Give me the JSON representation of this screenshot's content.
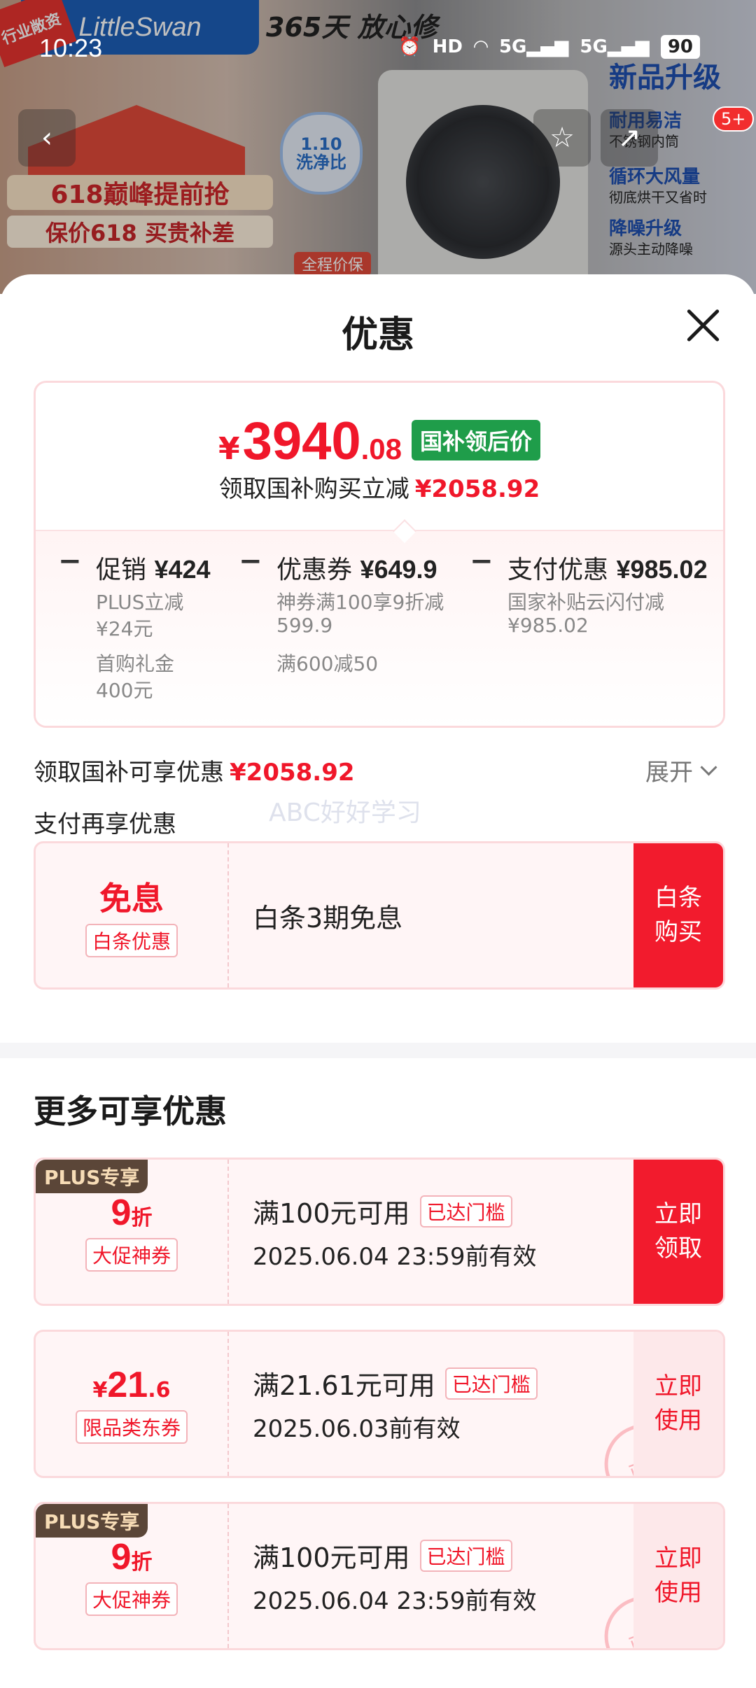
{
  "status_bar": {
    "time": "10:23",
    "icons": [
      "alarm-icon",
      "hd-icon",
      "wifi-icon",
      "signal-5g-1-icon",
      "signal-5g-2-icon"
    ],
    "hd_label": "HD",
    "net1": "5G",
    "net2": "5G",
    "battery": "90"
  },
  "banner": {
    "brand": "LittleSwan",
    "industry_tag": "行业敞资",
    "slogan": "365天 放心修",
    "promo_title": "618巅峰提前抢",
    "promo_sub": "保价618 买贵补差",
    "badge_110_line1": "1.10",
    "badge_110_line2": "洗净比",
    "full_guarantee": "全程价保",
    "feature_title": "新品升级",
    "features": [
      {
        "title": "耐用易洁",
        "sub": "不锈钢内筒"
      },
      {
        "title": "循环大风量",
        "sub": "彻底烘干又省时"
      },
      {
        "title": "降噪升级",
        "sub": "源头主动降噪"
      }
    ],
    "cart_badge": "5+"
  },
  "sheet": {
    "title": "优惠"
  },
  "price_card": {
    "currency": "¥",
    "price_int": "3940",
    "price_dec": ".08",
    "price_tag": "国补领后价",
    "subtitle": "领取国补购买立减",
    "subtitle_amount": "¥2058.92",
    "breakdown": [
      {
        "minus": "−",
        "title": "促销",
        "amount": "¥424",
        "lines": [
          "PLUS立减",
          "¥24元",
          "首购礼金",
          "400元"
        ]
      },
      {
        "minus": "−",
        "title": "优惠券",
        "amount": "¥649.9",
        "lines": [
          "神券满100享9折减",
          "599.9",
          "满600减50"
        ]
      },
      {
        "minus": "−",
        "title": "支付优惠",
        "amount": "¥985.02",
        "lines": [
          "国家补贴云闪付减",
          "¥985.02"
        ]
      }
    ]
  },
  "subsidy": {
    "label": "领取国补可享优惠",
    "amount": "¥2058.92",
    "expand": "展开"
  },
  "pay_again": "支付再享优惠",
  "watermark": "ABC好好学习",
  "baitiao": {
    "big": "免息",
    "tag": "白条优惠",
    "desc": "白条3期免息",
    "action": "白条\n购买"
  },
  "more_section_title": "更多可享优惠",
  "coupons": [
    {
      "plus": "PLUS专享",
      "value": "9",
      "unit": "折",
      "tag": "大促神券",
      "cond": "满100元可用",
      "reach": "已达门槛",
      "expiry": "2025.06.04 23:59前有效",
      "action": "立即\n领取"
    },
    {
      "plus": "",
      "yen": "¥",
      "value": "21",
      "dec": ".6",
      "tag": "限品类东券",
      "cond": "满21.61元可用",
      "reach": "已达门槛",
      "expiry": "2025.06.03前有效",
      "action": "立即\n使用",
      "stamp": "已领"
    },
    {
      "plus": "PLUS专享",
      "value": "9",
      "unit": "折",
      "tag": "大促神券",
      "cond": "满100元可用",
      "reach": "已达门槛",
      "expiry": "2025.06.04 23:59前有效",
      "action": "立即\n使用",
      "stamp": "已领"
    }
  ],
  "colors": {
    "accent_red": "#f0172a",
    "green_tag": "#1f9d4a",
    "plus_badge_bg": "#5b4638"
  }
}
